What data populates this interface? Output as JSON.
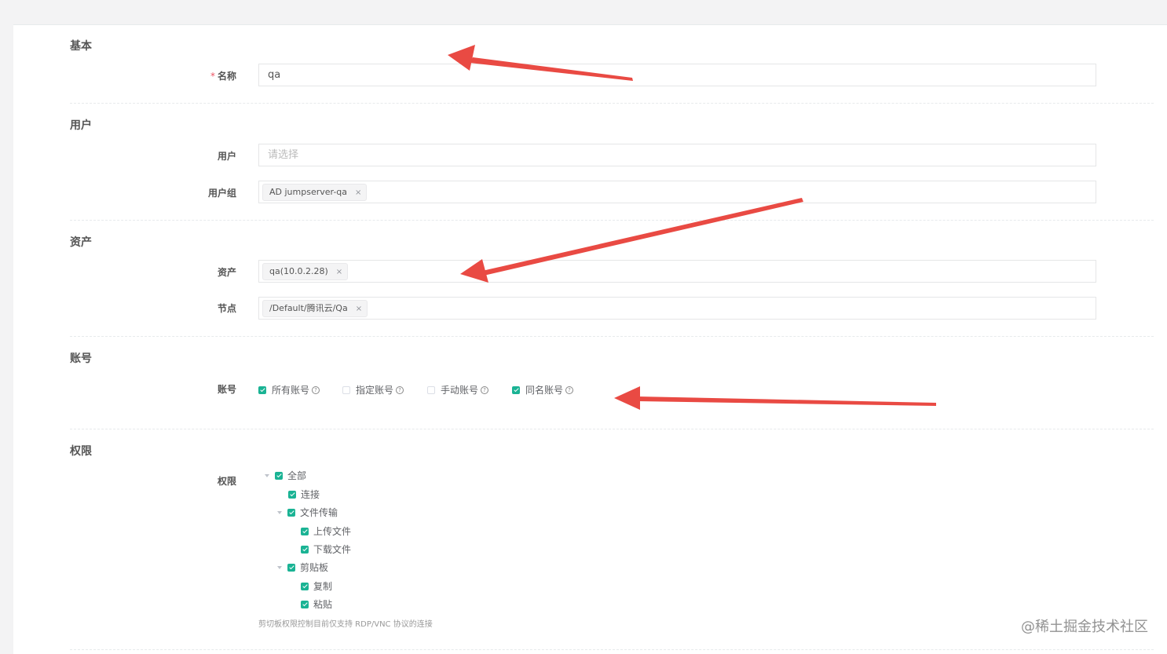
{
  "sections": {
    "basic": "基本",
    "user": "用户",
    "asset": "资产",
    "account": "账号",
    "permission": "权限"
  },
  "fields": {
    "name": {
      "required_mark": "*",
      "label": "名称",
      "value": "qa"
    },
    "users": {
      "label": "用户",
      "placeholder": "请选择"
    },
    "user_groups": {
      "label": "用户组",
      "tags": [
        "AD jumpserver-qa"
      ]
    },
    "assets": {
      "label": "资产",
      "tags": [
        "qa(10.0.2.28)"
      ]
    },
    "nodes": {
      "label": "节点",
      "tags": [
        "/Default/腾讯云/Qa"
      ]
    },
    "accounts": {
      "label": "账号",
      "options": [
        {
          "label": "所有账号",
          "checked": true
        },
        {
          "label": "指定账号",
          "checked": false
        },
        {
          "label": "手动账号",
          "checked": false
        },
        {
          "label": "同名账号",
          "checked": true
        }
      ]
    },
    "permissions": {
      "label": "权限",
      "tree": [
        {
          "label": "全部",
          "level": 0,
          "expandable": true,
          "checked": true
        },
        {
          "label": "连接",
          "level": 1,
          "expandable": false,
          "checked": true
        },
        {
          "label": "文件传输",
          "level": 1,
          "expandable": true,
          "checked": true
        },
        {
          "label": "上传文件",
          "level": 2,
          "expandable": false,
          "checked": true
        },
        {
          "label": "下载文件",
          "level": 2,
          "expandable": false,
          "checked": true
        },
        {
          "label": "剪贴板",
          "level": 1,
          "expandable": true,
          "checked": true
        },
        {
          "label": "复制",
          "level": 2,
          "expandable": false,
          "checked": true
        },
        {
          "label": "粘贴",
          "level": 2,
          "expandable": false,
          "checked": true
        }
      ],
      "help_text": "剪切板权限控制目前仅支持 RDP/VNC 协议的连接"
    }
  },
  "icons": {
    "tag_close": "×",
    "help": "?"
  },
  "colors": {
    "accent": "#1ab394",
    "arrow": "#e94a43",
    "required": "#ed5565"
  },
  "watermark": "@稀土掘金技术社区"
}
